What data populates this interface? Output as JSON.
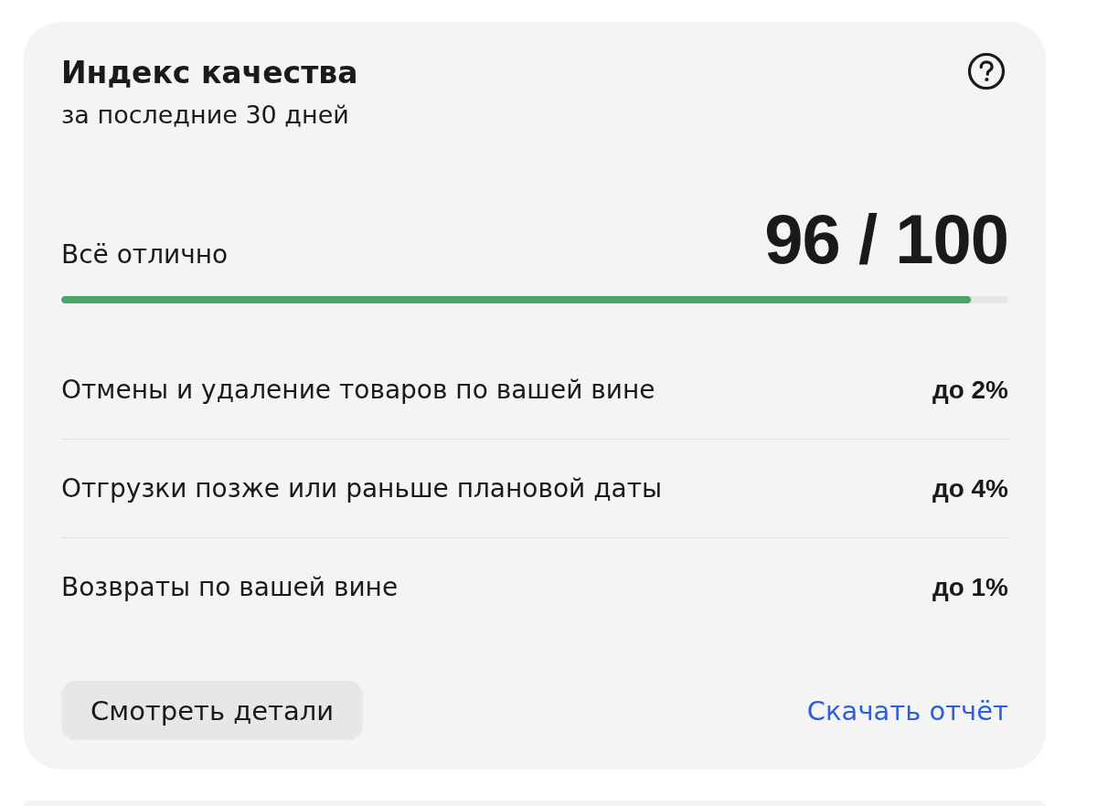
{
  "card": {
    "title": "Индекс качества",
    "subtitle": "за последние 30 дней",
    "status": "Всё отлично",
    "score": "96 / 100",
    "progress": {
      "level": 0.96
    },
    "metrics": [
      {
        "label": "Отмены и удаление товаров по вашей вине",
        "value": "до 2%"
      },
      {
        "label": "Отгрузки позже или раньше плановой даты",
        "value": "до 4%"
      },
      {
        "label": "Возвраты по вашей вине",
        "value": "до 1%"
      }
    ],
    "button": "Смотреть детали",
    "link": "Скачать отчёт"
  }
}
